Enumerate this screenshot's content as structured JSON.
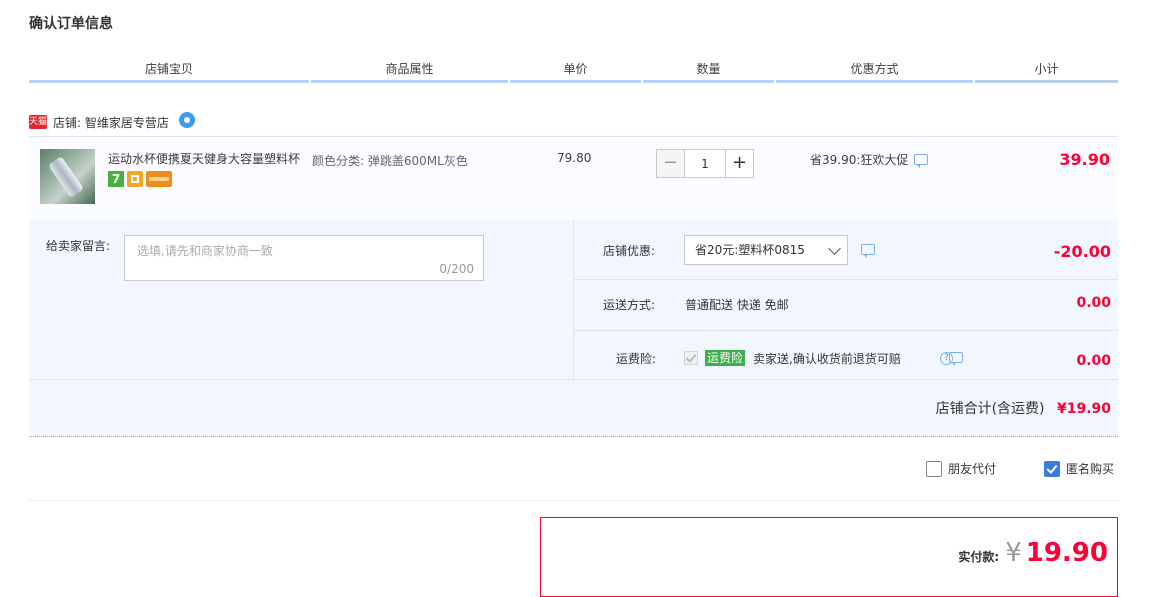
{
  "page_title": "确认订单信息",
  "columns": [
    "店铺宝贝",
    "商品属性",
    "单价",
    "数量",
    "优惠方式",
    "小计"
  ],
  "shop": {
    "badge": "天猫",
    "label": "店铺: 智维家居专营店"
  },
  "item": {
    "title": "运动水杯便携夏天健身大容量塑料杯",
    "svc_icon_7": "7",
    "attribute": "颜色分类: 弹跳盖600ML灰色",
    "price": "79.80",
    "quantity": "1",
    "qty_minus": "−",
    "qty_plus": "+",
    "promotion": "省39.90:狂欢大促",
    "subtotal": "39.90"
  },
  "message": {
    "label": "给卖家留言:",
    "placeholder": "选填,请先和商家协商一致",
    "count": "0/200"
  },
  "shop_discount": {
    "label": "店铺优惠:",
    "selected": "省20元:塑料杯0815",
    "amount": "-20.00"
  },
  "shipping": {
    "label": "运送方式:",
    "method": "普通配送 快递 免邮",
    "amount": "0.00"
  },
  "insurance": {
    "label": "运费险:",
    "tag": "运费险",
    "text": "卖家送,确认收货前退货可赔",
    "help": "?",
    "amount": "0.00"
  },
  "shop_total": {
    "label": "店铺合计(含运费)",
    "amount": "¥19.90"
  },
  "options": {
    "friend_pay": "朋友代付",
    "anonymous": "匿名购买",
    "anonymous_checked": true,
    "friend_pay_checked": false
  },
  "payment": {
    "label": "实付款:",
    "currency": "¥",
    "amount": "19.90"
  }
}
